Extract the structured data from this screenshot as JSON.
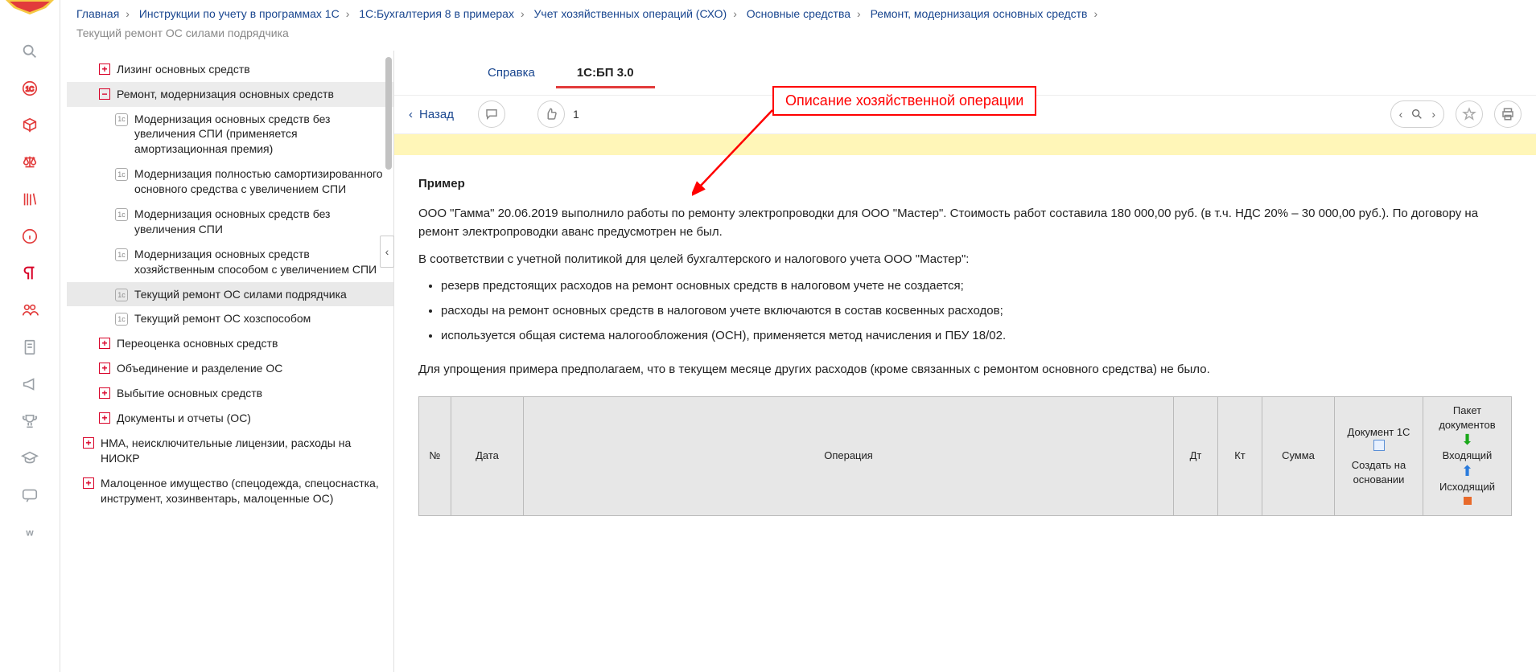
{
  "crumbs": [
    "Главная",
    "Инструкции по учету в программах 1С",
    "1С:Бухгалтерия 8 в примерах",
    "Учет хозяйственных операций (СХО)",
    "Основные средства",
    "Ремонт, модернизация основных средств"
  ],
  "crumb_current": "Текущий ремонт ОС силами подрядчика",
  "tree": {
    "n1": "Лизинг основных средств",
    "n2": "Ремонт, модернизация основных средств",
    "n3": "Модернизация основных средств без увеличения СПИ (применяется амортизационная премия)",
    "n4": "Модернизация полностью самортизированного основного средства с увеличением СПИ",
    "n5": "Модернизация основных средств без увеличения СПИ",
    "n6": "Модернизация основных средств хозяйственным способом с увеличением СПИ",
    "n7": "Текущий ремонт ОС силами подрядчика",
    "n8": "Текущий ремонт ОС хозспособом",
    "n9": "Переоценка основных средств",
    "n10": "Объединение и разделение ОС",
    "n11": "Выбытие основных средств",
    "n12": "Документы и отчеты (ОС)",
    "n13": "НМА, неисключительные лицензии, расходы на НИОКР",
    "n14": "Малоценное имущество (спецодежда, спецоснастка, инструмент, хозинвентарь, малоценные ОС)"
  },
  "tabs": {
    "ref": "Справка",
    "bp": "1С:БП 3.0"
  },
  "toolbar": {
    "back": "Назад",
    "like_count": "1"
  },
  "callout": "Описание хозяйственной операции",
  "article": {
    "h": "Пример",
    "p1": "ООО \"Гамма\" 20.06.2019 выполнило работы по ремонту электропроводки для ООО \"Мастер\". Стоимость работ составила 180 000,00 руб. (в т.ч. НДС 20% – 30 000,00 руб.). По договору на ремонт электропроводки аванс предусмотрен не был.",
    "p2": "В соответствии с учетной политикой для целей бухгалтерского и налогового учета ООО \"Мастер\":",
    "li1": "резерв предстоящих расходов на ремонт основных средств в налоговом учете не создается;",
    "li2": "расходы на ремонт основных средств в налоговом учете включаются в состав косвенных расходов;",
    "li3": "используется общая система налогообложения (ОСН), применяется метод начисления и ПБУ 18/02.",
    "p3": "Для упрощения примера предполагаем, что в текущем месяце других расходов (кроме связанных с ремонтом основного средства) не было."
  },
  "table": {
    "h_no": "№",
    "h_date": "Дата",
    "h_op": "Операция",
    "h_dt": "Дт",
    "h_kt": "Кт",
    "h_sum": "Сумма",
    "h_doc": "Документ 1С",
    "h_doc2": "Создать на основании",
    "h_pack": "Пакет документов",
    "h_in": "Входящий",
    "h_out": "Исходящий"
  }
}
